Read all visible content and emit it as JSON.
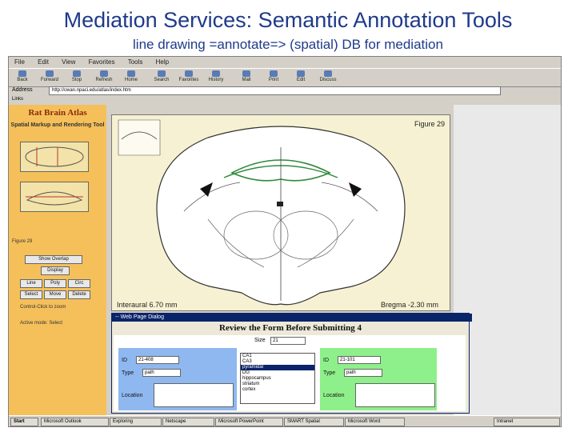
{
  "slide": {
    "title": "Mediation Services: Semantic Annotation Tools",
    "subtitle": "line drawing =annotate=> (spatial) DB for mediation"
  },
  "browser": {
    "menu": [
      "File",
      "Edit",
      "View",
      "Favorites",
      "Tools",
      "Help"
    ],
    "toolbar": [
      "Back",
      "Forward",
      "Stop",
      "Refresh",
      "Home",
      "Search",
      "Favorites",
      "History",
      "Mail",
      "Print",
      "Edit",
      "Discuss"
    ],
    "address_label": "Address",
    "address_value": "http://cwan.npaci.edu/atlas/index.htm",
    "links_label": "Links"
  },
  "atlas": {
    "title": "Rat Brain Atlas",
    "subtitle": "Spatial Markup and Rendering Tool",
    "figure_label": "Figure 29",
    "interaural": "Interaural 6.70 mm",
    "bregma": "Bregma -2.30 mm",
    "left_labels": [
      "Figure 29",
      "Control-Click to zoom",
      "Active mode: Select"
    ],
    "buttons": [
      "Show Overlap",
      "Display",
      "Line",
      "Poly",
      "Circ",
      "Select",
      "Move",
      "Delete"
    ]
  },
  "dialog": {
    "title_bar": "-- Web Page Dialog",
    "heading": "Review the Form Before Submitting 4",
    "size_label": "Size",
    "size_value": "21",
    "left_fields": {
      "id_label": "ID",
      "id_value": "21-408",
      "type_label": "Type",
      "type_value": "path",
      "location_label": "Location"
    },
    "list_items": [
      "CA1",
      "CA3",
      "pyramidal",
      "DG",
      "hippocampus",
      "striatum",
      "cortex"
    ],
    "selected_index": 2,
    "right_fields": {
      "id_label": "ID",
      "id_value": "21-101",
      "type_label": "Type",
      "type_value": "path",
      "location_label": "Location"
    }
  },
  "taskbar": {
    "start": "Start",
    "tasks": [
      "Microsoft Outlook",
      "Exploring",
      "Netscape",
      "Microsoft PowerPoint",
      "SMART Spatial",
      "Microsoft Word"
    ],
    "tray": "Intranet"
  },
  "colors": {
    "title": "#1f3a8a",
    "atlas_panel": "#f5c05a",
    "left_form": "#8fb8f0",
    "right_form": "#8ef08a",
    "annotation_green": "#2f8a3a"
  }
}
